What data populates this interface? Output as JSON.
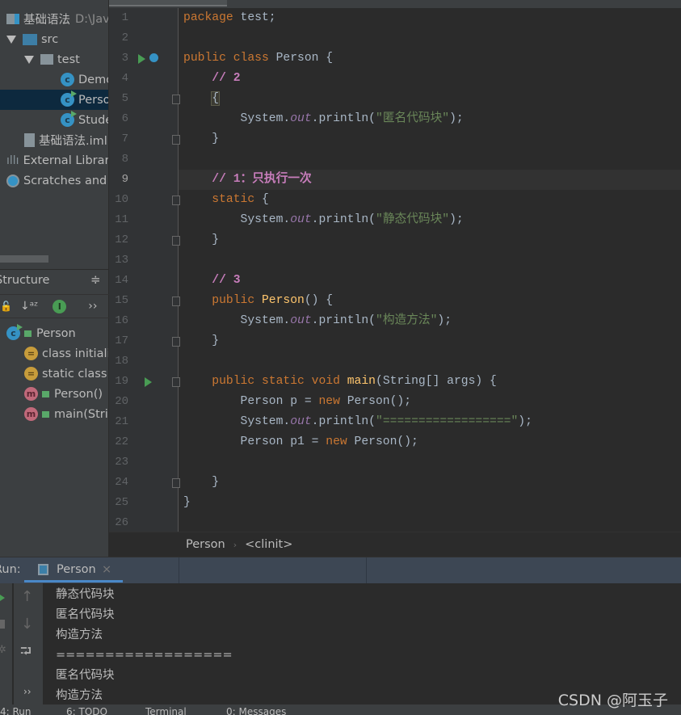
{
  "project": {
    "items": [
      {
        "label": "基础语法",
        "suffix": "D:\\Jav",
        "icon": "module-icon"
      },
      {
        "label": "src",
        "icon": "folder-icon"
      },
      {
        "label": "test",
        "icon": "package-icon"
      },
      {
        "label": "Demo",
        "icon": "class-icon"
      },
      {
        "label": "Person",
        "icon": "runnable-class-icon",
        "selected": true
      },
      {
        "label": "Student",
        "icon": "runnable-class-icon"
      },
      {
        "label": "基础语法.iml",
        "icon": "iml-file-icon"
      },
      {
        "label": "External Libraries",
        "icon": "library-icon"
      },
      {
        "label": "Scratches and Consoles",
        "icon": "scratches-icon"
      }
    ]
  },
  "structure": {
    "title": "Structure",
    "more": "››",
    "items": [
      {
        "label": "Person",
        "icon": "runnable-class-icon"
      },
      {
        "label": "class initializer",
        "icon": "initializer-icon"
      },
      {
        "label": "static class initializer",
        "icon": "static-initializer-icon"
      },
      {
        "label": "Person()",
        "icon": "method-icon"
      },
      {
        "label": "main(String[])",
        "icon": "method-icon"
      }
    ]
  },
  "editor": {
    "current_line": 9,
    "lines": [
      [
        [
          "package",
          "kw"
        ],
        [
          " test;",
          ""
        ]
      ],
      [],
      [
        [
          "public class ",
          "kw"
        ],
        [
          "Person {",
          ""
        ]
      ],
      [
        [
          "    // 2",
          "cm"
        ]
      ],
      [
        [
          "    ",
          ""
        ],
        [
          "{",
          "bh"
        ]
      ],
      [
        [
          "        System.",
          ""
        ],
        [
          "out",
          "fld"
        ],
        [
          ".println(",
          ""
        ],
        [
          "\"匿名代码块\"",
          "str"
        ],
        [
          ");",
          ""
        ]
      ],
      [
        [
          "    }",
          ""
        ]
      ],
      [],
      [
        [
          "    // 1：只执行一次",
          "cm"
        ]
      ],
      [
        [
          "    static ",
          "kw"
        ],
        [
          "{",
          ""
        ]
      ],
      [
        [
          "        System.",
          ""
        ],
        [
          "out",
          "fld"
        ],
        [
          ".println(",
          ""
        ],
        [
          "\"静态代码块\"",
          "str"
        ],
        [
          ");",
          ""
        ]
      ],
      [
        [
          "    }",
          ""
        ]
      ],
      [],
      [
        [
          "    // 3",
          "cm"
        ]
      ],
      [
        [
          "    public ",
          "kw"
        ],
        [
          "Person",
          "fn"
        ],
        [
          "() {",
          ""
        ]
      ],
      [
        [
          "        System.",
          ""
        ],
        [
          "out",
          "fld"
        ],
        [
          ".println(",
          ""
        ],
        [
          "\"构造方法\"",
          "str"
        ],
        [
          ");",
          ""
        ]
      ],
      [
        [
          "    }",
          ""
        ]
      ],
      [],
      [
        [
          "    public static void ",
          "kw"
        ],
        [
          "main",
          "fn"
        ],
        [
          "(String[] args) {",
          ""
        ]
      ],
      [
        [
          "        Person p = ",
          ""
        ],
        [
          "new ",
          "kw"
        ],
        [
          "Person();",
          ""
        ]
      ],
      [
        [
          "        System.",
          ""
        ],
        [
          "out",
          "fld"
        ],
        [
          ".println(",
          ""
        ],
        [
          "\"==================\"",
          "str"
        ],
        [
          ");",
          ""
        ]
      ],
      [
        [
          "        Person p1 = ",
          ""
        ],
        [
          "new ",
          "kw"
        ],
        [
          "Person();",
          ""
        ]
      ],
      [],
      [
        [
          "    }",
          ""
        ]
      ],
      [
        [
          "}",
          ""
        ]
      ],
      []
    ]
  },
  "breadcrumb": [
    "Person",
    "<clinit>"
  ],
  "run": {
    "label": "Run:",
    "tab": "Person",
    "close": "×",
    "more": "››",
    "output": [
      "静态代码块",
      "匿名代码块",
      "构造方法",
      "==================",
      "匿名代码块",
      "构造方法"
    ]
  },
  "status": {
    "items": [
      "4: Run",
      "6: TODO",
      "Terminal",
      "0: Messages"
    ]
  },
  "watermark": "CSDN @阿玉子"
}
